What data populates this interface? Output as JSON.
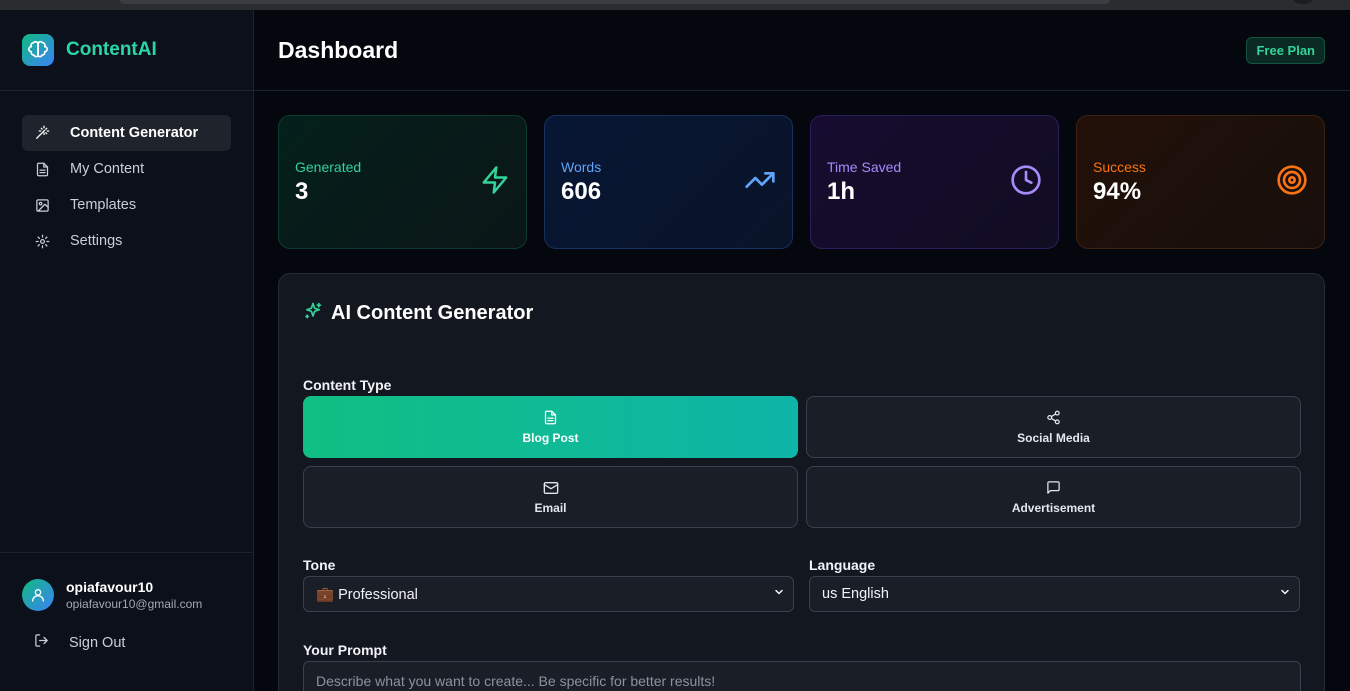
{
  "brand": {
    "name": "ContentAI",
    "logo_icon": "brain-icon"
  },
  "nav": {
    "items": [
      {
        "label": "Content Generator",
        "icon": "magic-wand-icon",
        "active": true
      },
      {
        "label": "My Content",
        "icon": "document-icon",
        "active": false
      },
      {
        "label": "Templates",
        "icon": "image-icon",
        "active": false
      },
      {
        "label": "Settings",
        "icon": "gear-icon",
        "active": false
      }
    ]
  },
  "user": {
    "name": "opiafavour10",
    "email": "opiafavour10@gmail.com"
  },
  "signout": {
    "label": "Sign Out"
  },
  "header": {
    "title": "Dashboard",
    "plan_badge": "Free Plan"
  },
  "stats": [
    {
      "label": "Generated",
      "value": "3",
      "icon": "lightning-icon",
      "color": "#34d399"
    },
    {
      "label": "Words",
      "value": "606",
      "icon": "trending-up-icon",
      "color": "#60a5fa"
    },
    {
      "label": "Time Saved",
      "value": "1h",
      "icon": "clock-icon",
      "color": "#a78bfa"
    },
    {
      "label": "Success",
      "value": "94%",
      "icon": "target-icon",
      "color": "#f97316"
    }
  ],
  "generator": {
    "title": "AI Content Generator",
    "content_type_label": "Content Type",
    "content_types": [
      {
        "label": "Blog Post",
        "icon": "document-icon",
        "selected": true
      },
      {
        "label": "Social Media",
        "icon": "share-icon",
        "selected": false
      },
      {
        "label": "Email",
        "icon": "mail-icon",
        "selected": false
      },
      {
        "label": "Advertisement",
        "icon": "chat-bubble-icon",
        "selected": false
      }
    ],
    "tone_label": "Tone",
    "tone_value": "💼 Professional",
    "language_label": "Language",
    "language_value": "us English",
    "prompt_label": "Your Prompt",
    "prompt_placeholder": "Describe what you want to create... Be specific for better results!"
  }
}
